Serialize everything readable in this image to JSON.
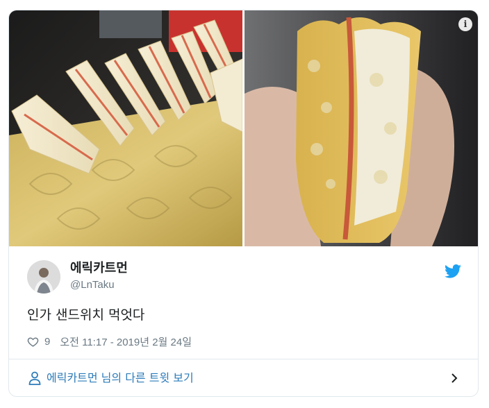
{
  "tweet": {
    "display_name": "에릭카트먼",
    "handle": "@LnTaku",
    "text": "인가 샌드위치 먹엇다",
    "likes": "9",
    "timestamp": "오전 11:17 - 2019년 2월 24일"
  },
  "media": {
    "info_symbol": "i",
    "photo_count": 2
  },
  "footer": {
    "more_tweets_label": "에릭카트먼 님의 다른 트윗 보기"
  },
  "colors": {
    "text": "#1c2022",
    "secondary": "#697882",
    "link": "#2b7bb9",
    "twitter_blue": "#1da1f2",
    "border": "#e1e8ed"
  },
  "icons": {
    "info": "info-icon",
    "twitter": "twitter-bird-icon",
    "like": "heart-icon",
    "person": "person-icon",
    "chevron": "chevron-right-icon"
  }
}
